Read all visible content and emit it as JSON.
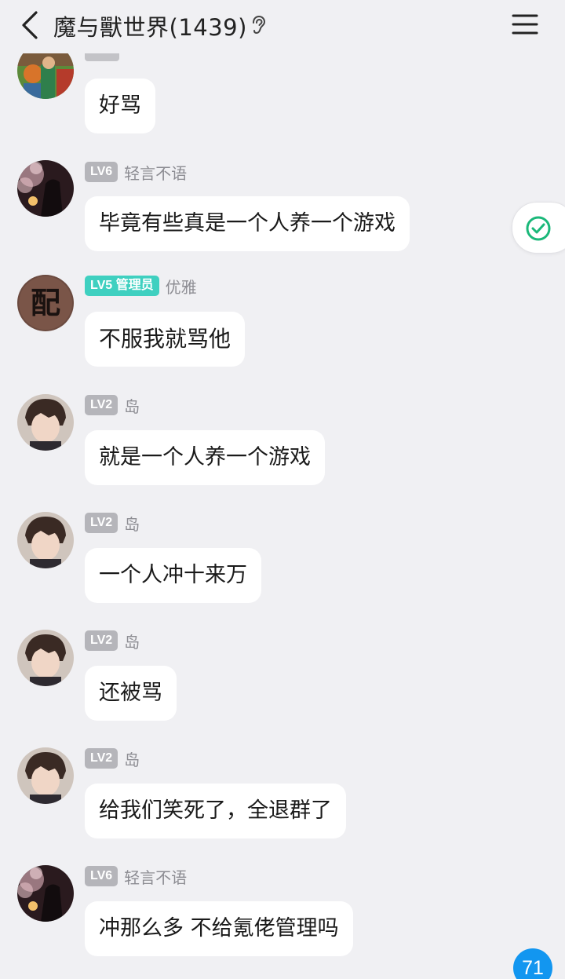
{
  "header": {
    "title": "魔与獸世界(1439)",
    "back_icon": "chevron-left-icon",
    "ear_icon": "ear-icon",
    "menu_icon": "hamburger-menu-icon"
  },
  "messages": [
    {
      "text": "好骂",
      "avatar": "avatar-cosplay"
    },
    {
      "level": "LV6",
      "name": "轻言不语",
      "text": "毕竟有些真是一个人养一个游戏",
      "avatar": "avatar-sakura"
    },
    {
      "level": "LV5 管理员",
      "name": "优雅",
      "text": "不服我就骂他",
      "avatar": "avatar-calligraphy",
      "avatar_char": "配"
    },
    {
      "level": "LV2",
      "name": "岛",
      "text": "就是一个人养一个游戏",
      "avatar": "avatar-anime-boy"
    },
    {
      "level": "LV2",
      "name": "岛",
      "text": "一个人冲十来万",
      "avatar": "avatar-anime-boy"
    },
    {
      "level": "LV2",
      "name": "岛",
      "text": "还被骂",
      "avatar": "avatar-anime-boy"
    },
    {
      "level": "LV2",
      "name": "岛",
      "text": "给我们笑死了，全退群了",
      "avatar": "avatar-anime-boy"
    },
    {
      "level": "LV6",
      "name": "轻言不语",
      "text": "冲那么多 不给氪佬管理吗",
      "avatar": "avatar-sakura"
    }
  ],
  "side_button_icon": "check-circle-icon",
  "unread_badge": "71",
  "colors": {
    "background": "#f0f0f3",
    "bubble": "#ffffff",
    "level_badge": "#b5b5ba",
    "admin_badge": "#3fd0c0",
    "check_green": "#1bb87a",
    "unread_blue": "#1296f0"
  }
}
